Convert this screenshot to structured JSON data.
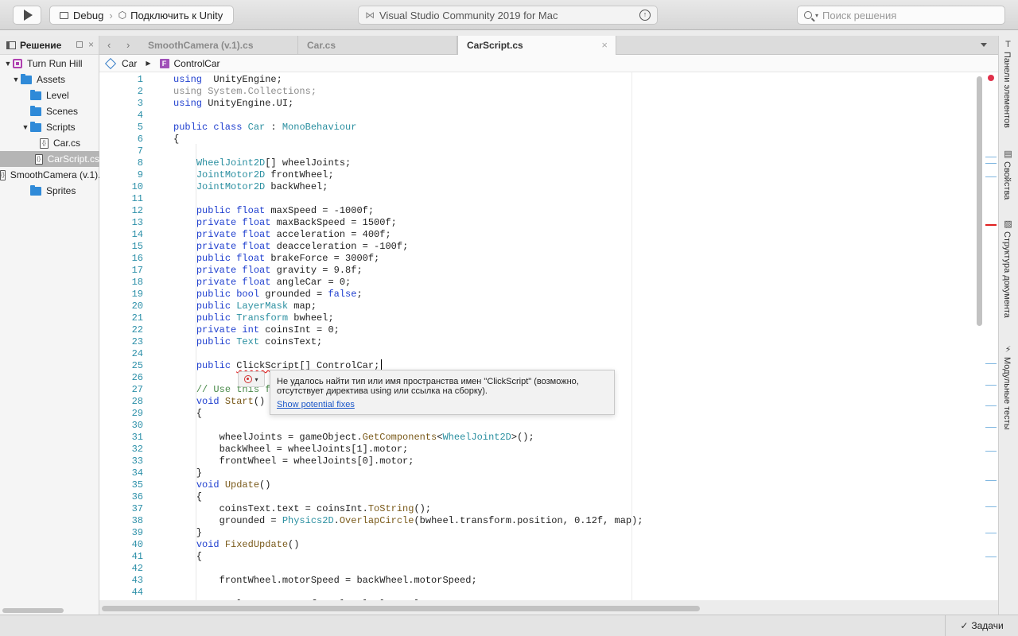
{
  "toolbar": {
    "config": "Debug",
    "target": "Подключить к Unity",
    "app_title": "Visual Studio Community 2019 for Mac",
    "search_placeholder": "Поиск решения"
  },
  "solution": {
    "title": "Решение",
    "items": [
      {
        "label": "Turn Run Hill",
        "kind": "project",
        "indent": 0,
        "expanded": true
      },
      {
        "label": "Assets",
        "kind": "folder",
        "indent": 1,
        "expanded": true
      },
      {
        "label": "Level",
        "kind": "folder",
        "indent": 2
      },
      {
        "label": "Scenes",
        "kind": "folder",
        "indent": 2
      },
      {
        "label": "Scripts",
        "kind": "folder",
        "indent": 2,
        "expanded": true
      },
      {
        "label": "Car.cs",
        "kind": "file",
        "indent": 3
      },
      {
        "label": "CarScript.cs",
        "kind": "file",
        "indent": 3,
        "selected": true
      },
      {
        "label": "SmoothCamera (v.1).cs",
        "kind": "file",
        "indent": 3
      },
      {
        "label": "Sprites",
        "kind": "folder",
        "indent": 2
      }
    ]
  },
  "tabs": [
    {
      "label": "SmoothCamera (v.1).cs",
      "active": false
    },
    {
      "label": "Car.cs",
      "active": false
    },
    {
      "label": "CarScript.cs",
      "active": true
    }
  ],
  "breadcrumb": {
    "class": "Car",
    "member": "ControlCar"
  },
  "code_lines": [
    [
      [
        "kw",
        "using"
      ],
      [
        "",
        "  UnityEngine;"
      ]
    ],
    [
      [
        "dim",
        "using System.Collections;"
      ]
    ],
    [
      [
        "kw",
        "using"
      ],
      [
        "",
        " UnityEngine.UI;"
      ]
    ],
    [],
    [
      [
        "kw",
        "public class"
      ],
      [
        "",
        " "
      ],
      [
        "ty",
        "Car"
      ],
      [
        "",
        " : "
      ],
      [
        "ty",
        "MonoBehaviour"
      ]
    ],
    [
      [
        "",
        "{"
      ]
    ],
    [],
    [
      [
        "",
        "    "
      ],
      [
        "ty",
        "WheelJoint2D"
      ],
      [
        "",
        "[] wheelJoints;"
      ]
    ],
    [
      [
        "",
        "    "
      ],
      [
        "ty",
        "JointMotor2D"
      ],
      [
        "",
        " frontWheel;"
      ]
    ],
    [
      [
        "",
        "    "
      ],
      [
        "ty",
        "JointMotor2D"
      ],
      [
        "",
        " backWheel;"
      ]
    ],
    [],
    [
      [
        "",
        "    "
      ],
      [
        "kw",
        "public float"
      ],
      [
        "",
        " maxSpeed = -1000f;"
      ]
    ],
    [
      [
        "",
        "    "
      ],
      [
        "kw",
        "private float"
      ],
      [
        "",
        " maxBackSpeed = 1500f;"
      ]
    ],
    [
      [
        "",
        "    "
      ],
      [
        "kw",
        "private float"
      ],
      [
        "",
        " acceleration = 400f;"
      ]
    ],
    [
      [
        "",
        "    "
      ],
      [
        "kw",
        "private float"
      ],
      [
        "",
        " deacceleration = -100f;"
      ]
    ],
    [
      [
        "",
        "    "
      ],
      [
        "kw",
        "public float"
      ],
      [
        "",
        " brakeForce = 3000f;"
      ]
    ],
    [
      [
        "",
        "    "
      ],
      [
        "kw",
        "private float"
      ],
      [
        "",
        " gravity = 9.8f;"
      ]
    ],
    [
      [
        "",
        "    "
      ],
      [
        "kw",
        "private float"
      ],
      [
        "",
        " angleCar = 0;"
      ]
    ],
    [
      [
        "",
        "    "
      ],
      [
        "kw",
        "public bool"
      ],
      [
        "",
        " grounded = "
      ],
      [
        "kw",
        "false"
      ],
      [
        "",
        ";"
      ]
    ],
    [
      [
        "",
        "    "
      ],
      [
        "kw",
        "public"
      ],
      [
        "",
        " "
      ],
      [
        "ty",
        "LayerMask"
      ],
      [
        "",
        " map;"
      ]
    ],
    [
      [
        "",
        "    "
      ],
      [
        "kw",
        "public"
      ],
      [
        "",
        " "
      ],
      [
        "ty",
        "Transform"
      ],
      [
        "",
        " bwheel;"
      ]
    ],
    [
      [
        "",
        "    "
      ],
      [
        "kw",
        "private int"
      ],
      [
        "",
        " coinsInt = 0;"
      ]
    ],
    [
      [
        "",
        "    "
      ],
      [
        "kw",
        "public"
      ],
      [
        "",
        " "
      ],
      [
        "ty",
        "Text"
      ],
      [
        "",
        " coinsText;"
      ]
    ],
    [],
    [
      [
        "",
        "    "
      ],
      [
        "kw",
        "public"
      ],
      [
        "",
        " "
      ],
      [
        "err",
        "ClickScript"
      ],
      [
        "",
        "[] ControlCar;"
      ]
    ],
    [],
    [
      [
        "",
        "    "
      ],
      [
        "cm",
        "// Use this f"
      ]
    ],
    [
      [
        "",
        "    "
      ],
      [
        "kw",
        "void"
      ],
      [
        "",
        " "
      ],
      [
        "fn",
        "Start"
      ],
      [
        "",
        "()"
      ]
    ],
    [
      [
        "",
        "    {"
      ]
    ],
    [],
    [
      [
        "",
        "        wheelJoints = gameObject."
      ],
      [
        "fn",
        "GetComponents"
      ],
      [
        "",
        "<"
      ],
      [
        "ty",
        "WheelJoint2D"
      ],
      [
        "",
        ">();"
      ]
    ],
    [
      [
        "",
        "        backWheel = wheelJoints[1].motor;"
      ]
    ],
    [
      [
        "",
        "        frontWheel = wheelJoints[0].motor;"
      ]
    ],
    [
      [
        "",
        "    }"
      ]
    ],
    [
      [
        "",
        "    "
      ],
      [
        "kw",
        "void"
      ],
      [
        "",
        " "
      ],
      [
        "fn",
        "Update"
      ],
      [
        "",
        "()"
      ]
    ],
    [
      [
        "",
        "    {"
      ]
    ],
    [
      [
        "",
        "        coinsText.text = coinsInt."
      ],
      [
        "fn",
        "ToString"
      ],
      [
        "",
        "();"
      ]
    ],
    [
      [
        "",
        "        grounded = "
      ],
      [
        "ty",
        "Physics2D"
      ],
      [
        "",
        "."
      ],
      [
        "fn",
        "OverlapCircle"
      ],
      [
        "",
        "(bwheel.transform.position, 0.12f, map);"
      ]
    ],
    [
      [
        "",
        "    }"
      ]
    ],
    [
      [
        "",
        "    "
      ],
      [
        "kw",
        "void"
      ],
      [
        "",
        " "
      ],
      [
        "fn",
        "FixedUpdate"
      ],
      [
        "",
        "()"
      ]
    ],
    [
      [
        "",
        "    {"
      ]
    ],
    [],
    [
      [
        "",
        "        frontWheel.motorSpeed = backWheel.motorSpeed;"
      ]
    ],
    [],
    [
      [
        "",
        "        angleCar = transform.localEulerAngles.z;"
      ]
    ]
  ],
  "diagnostic": {
    "message": "Не удалось найти тип или имя пространства имен \"ClickScript\" (возможно, отсутствует директива using или ссылка на сборку).",
    "link": "Show potential fixes"
  },
  "right_pads": [
    "Панели элементов",
    "Свойства",
    "Структура документа",
    "Модульные тесты"
  ],
  "status": {
    "tasks": "Задачи"
  },
  "colors": {
    "accent": "#2f8ad8",
    "error": "#e02020",
    "keyword": "#1f3fcf",
    "type": "#2a8fa0"
  }
}
